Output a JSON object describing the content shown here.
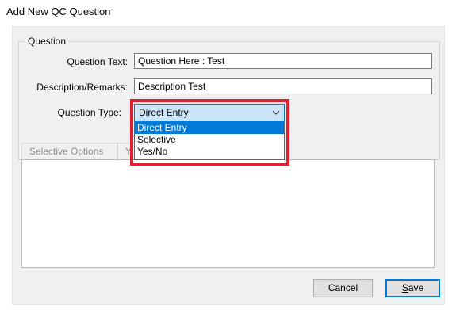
{
  "window": {
    "title": "Add New QC Question"
  },
  "question_group": {
    "legend": "Question",
    "question_text_label": "Question Text:",
    "question_text_value": "Question Here : Test",
    "description_label": "Description/Remarks:",
    "description_value": "Description Test",
    "question_type_label": "Question Type:",
    "question_type_value": "Direct Entry",
    "question_type_options": [
      "Direct Entry",
      "Selective",
      "Yes/No"
    ],
    "question_type_selected_index": 0
  },
  "tabs": {
    "items": [
      "Selective Options",
      "Y"
    ]
  },
  "buttons": {
    "cancel_label": "Cancel",
    "save_mnemonic": "S",
    "save_rest": "ave"
  },
  "icons": {
    "combo_arrow": "chevron-down-icon"
  },
  "colors": {
    "selection_blue": "#0078d7",
    "combo_focus_bg": "#cce4f7",
    "annotation_red": "#e0202f",
    "dialog_bg": "#f0f0f0"
  }
}
